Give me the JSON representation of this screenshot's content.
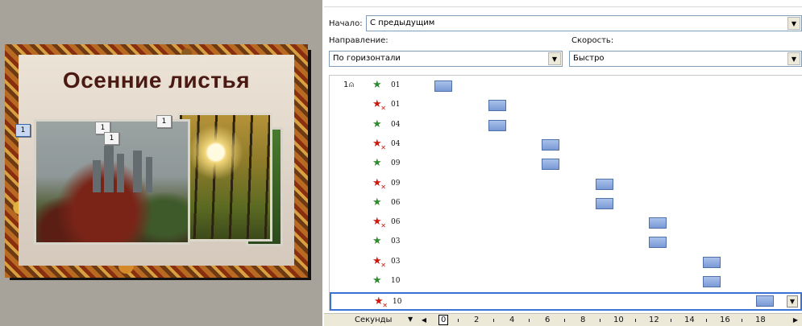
{
  "slide": {
    "title": "Осенние листья",
    "badges": [
      "1",
      "1",
      "1",
      "1"
    ]
  },
  "pane": {
    "start_label": "Начало:",
    "start_value": "С предыдущим",
    "direction_label": "Направление:",
    "direction_value": "По горизонтали",
    "speed_label": "Скорость:",
    "speed_value": "Быстро"
  },
  "animation_list": [
    {
      "seq": "1",
      "name": "01",
      "effect": "entrance",
      "slot": 0
    },
    {
      "seq": "",
      "name": "01",
      "effect": "exit",
      "slot": 1
    },
    {
      "seq": "",
      "name": "04",
      "effect": "entrance",
      "slot": 1
    },
    {
      "seq": "",
      "name": "04",
      "effect": "exit",
      "slot": 2
    },
    {
      "seq": "",
      "name": "09",
      "effect": "entrance",
      "slot": 2
    },
    {
      "seq": "",
      "name": "09",
      "effect": "exit",
      "slot": 3
    },
    {
      "seq": "",
      "name": "06",
      "effect": "entrance",
      "slot": 3
    },
    {
      "seq": "",
      "name": "06",
      "effect": "exit",
      "slot": 4
    },
    {
      "seq": "",
      "name": "03",
      "effect": "entrance",
      "slot": 4
    },
    {
      "seq": "",
      "name": "03",
      "effect": "exit",
      "slot": 5
    },
    {
      "seq": "",
      "name": "10",
      "effect": "entrance",
      "slot": 5
    },
    {
      "seq": "",
      "name": "10",
      "effect": "exit",
      "slot": 6,
      "selected": true
    }
  ],
  "timeline": {
    "unit_label": "Секунды",
    "ticks": [
      "0",
      "2",
      "4",
      "6",
      "8",
      "10",
      "12",
      "14",
      "16",
      "18"
    ],
    "current": "0"
  },
  "icons": {
    "mouse": "mouse-click-icon",
    "entrance": "green-star-icon",
    "exit": "red-star-exit-icon",
    "dropdown": "chevron-down-icon"
  },
  "colors": {
    "entrance_star": "#2e8b2e",
    "exit_star": "#cc1a10",
    "bar": "#8fadde",
    "selection": "#3b73d4",
    "title": "#4a1a12"
  }
}
